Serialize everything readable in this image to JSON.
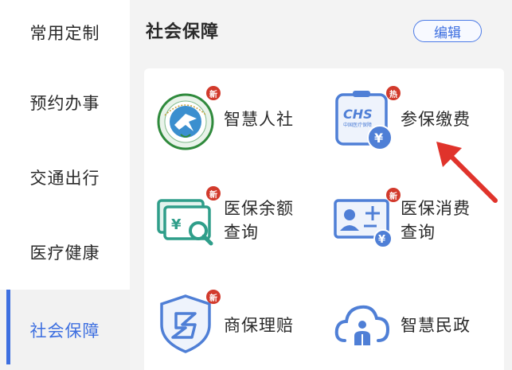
{
  "sidebar": {
    "items": [
      {
        "label": "常用定制"
      },
      {
        "label": "预约办事"
      },
      {
        "label": "交通出行"
      },
      {
        "label": "医疗健康"
      },
      {
        "label": "社会保障"
      }
    ]
  },
  "header": {
    "title": "社会保障",
    "edit_label": "编辑"
  },
  "services": [
    {
      "label": "智慧人社",
      "badge": "新",
      "icon": "ren-she-logo-icon"
    },
    {
      "label": "参保缴费",
      "badge": "热",
      "icon": "chs-card-yuan-icon"
    },
    {
      "label": "医保余额\n查询",
      "badge": "新",
      "icon": "balance-search-icon"
    },
    {
      "label": "医保消费\n查询",
      "badge": "新",
      "icon": "id-card-yuan-icon"
    },
    {
      "label": "商保理赔",
      "badge": "新",
      "icon": "shield-icon"
    },
    {
      "label": "智慧民政",
      "badge": "",
      "icon": "cloud-person-icon"
    }
  ],
  "chs_logo_text": "CHS",
  "chs_logo_subtext": "中国医疗保障",
  "colors": {
    "accent": "#3d6fe0",
    "badge_red": "#d23a2c",
    "icon_blue": "#4f7fd6",
    "icon_teal": "#2f9e8a",
    "arrow_red": "#e0332b"
  }
}
